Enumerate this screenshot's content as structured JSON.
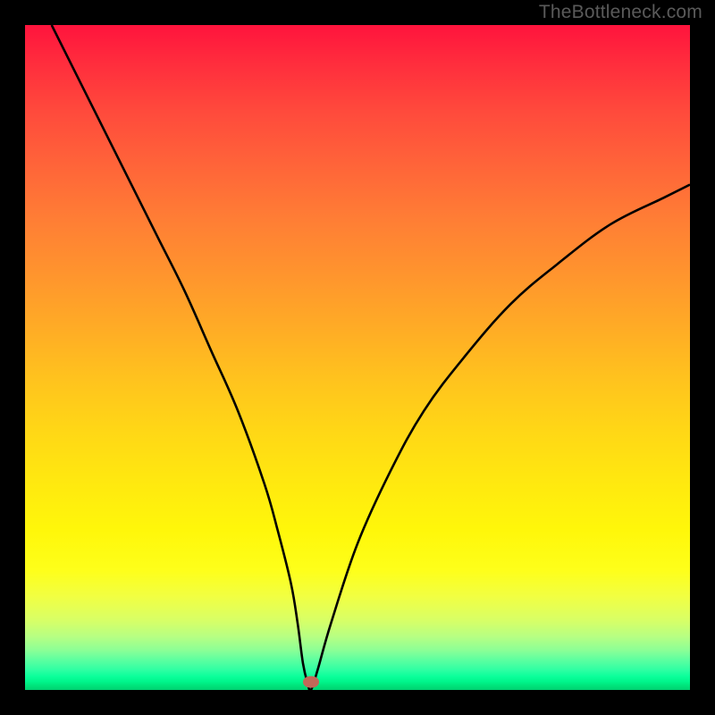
{
  "watermark": "TheBottleneck.com",
  "chart_data": {
    "type": "line",
    "title": "",
    "xlabel": "",
    "ylabel": "",
    "xlim": [
      0,
      100
    ],
    "ylim": [
      0,
      100
    ],
    "grid": false,
    "legend": false,
    "background": "rainbow-gradient",
    "series": [
      {
        "name": "bottleneck-curve",
        "color": "#000000",
        "x": [
          4,
          8,
          12,
          16,
          20,
          24,
          28,
          32,
          36,
          38,
          40,
          41,
          41.8,
          42.5,
          43,
          44,
          46,
          50,
          55,
          60,
          66,
          73,
          80,
          88,
          96,
          100
        ],
        "values": [
          100,
          92,
          84,
          76,
          68,
          60,
          51,
          42,
          31,
          24,
          16,
          10,
          4,
          1,
          0,
          3,
          10,
          22,
          33,
          42,
          50,
          58,
          64,
          70,
          74,
          76
        ]
      }
    ],
    "marker": {
      "x": 43,
      "y": 1.2,
      "color": "#c16858"
    }
  }
}
